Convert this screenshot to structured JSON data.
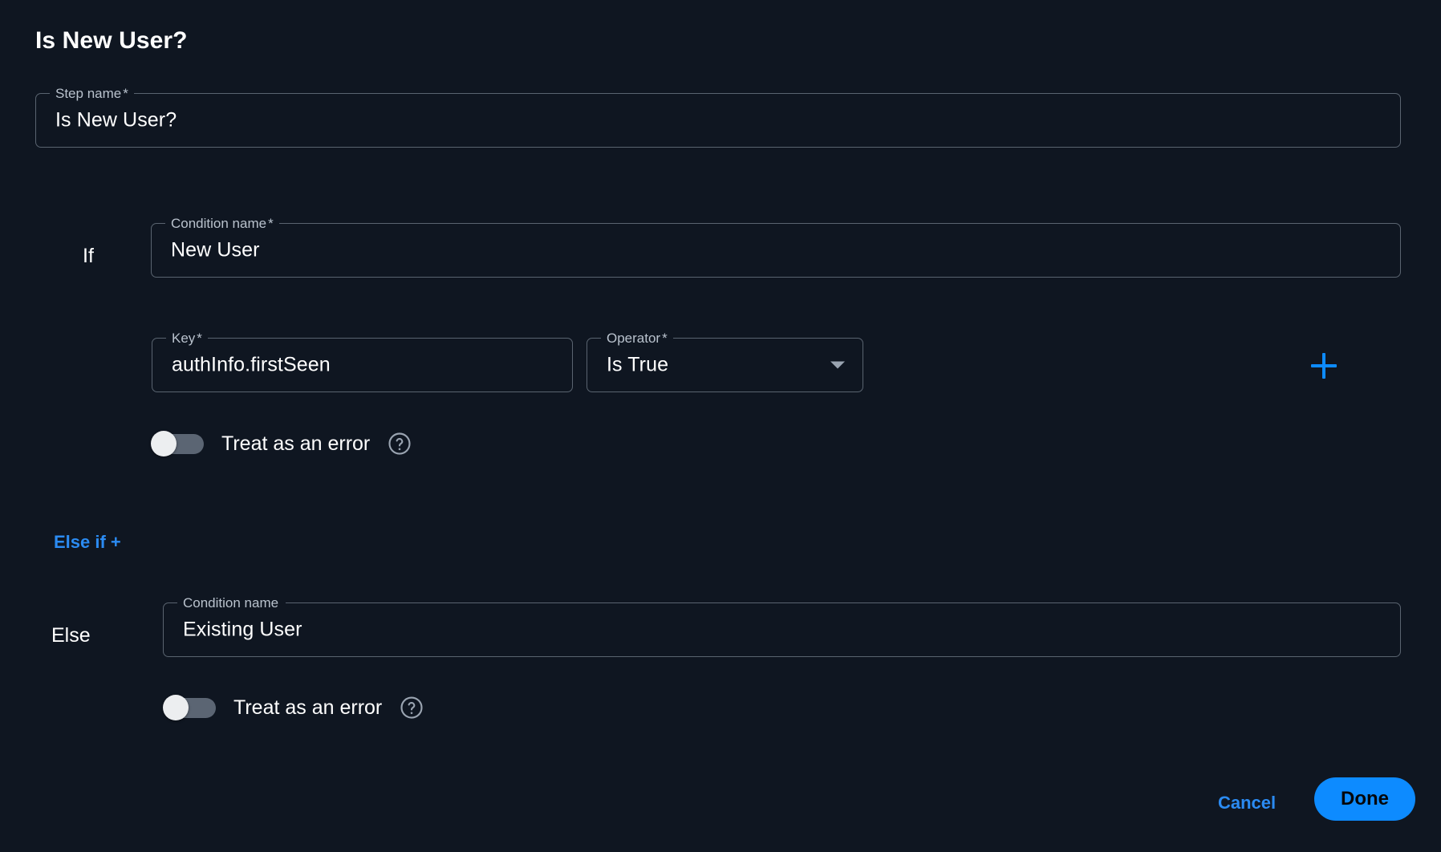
{
  "dialog": {
    "title": "Is New User?"
  },
  "step_name_field": {
    "label": "Step name",
    "required_mark": "*",
    "value": "Is New User?",
    "placeholder": "Step name"
  },
  "if_branch": {
    "keyword": "If",
    "condition_name_field": {
      "label": "Condition name",
      "required_mark": "*",
      "value": "New User",
      "placeholder": "Condition name"
    },
    "key_field": {
      "label": "Key",
      "required_mark": "*",
      "value": "authInfo.firstSeen",
      "placeholder": "Key"
    },
    "operator_field": {
      "label": "Operator",
      "required_mark": "*",
      "value": "Is True",
      "placeholder": "Operator",
      "icon": "chevron-down-icon"
    },
    "add_condition_icon": "plus-icon",
    "treat_as_error": {
      "label": "Treat as an error",
      "state": "off",
      "help_icon": "help-circle-icon"
    }
  },
  "else_if_link": {
    "label": "Else if +"
  },
  "else_branch": {
    "keyword": "Else",
    "condition_name_field": {
      "label": "Condition name",
      "required_mark": "",
      "value": "Existing User",
      "placeholder": "Condition name"
    },
    "treat_as_error": {
      "label": "Treat as an error",
      "state": "off",
      "help_icon": "help-circle-icon"
    }
  },
  "footer": {
    "cancel_label": "Cancel",
    "done_label": "Done"
  },
  "colors": {
    "background": "#0f1621",
    "accent_blue": "#0d8bff",
    "link_blue": "#2b8bf2",
    "field_border": "#5a6470",
    "label_text": "#b9c2cd",
    "value_text": "#ffffff",
    "toggle_track_off": "#5b6573",
    "toggle_knob": "#eceef0"
  }
}
